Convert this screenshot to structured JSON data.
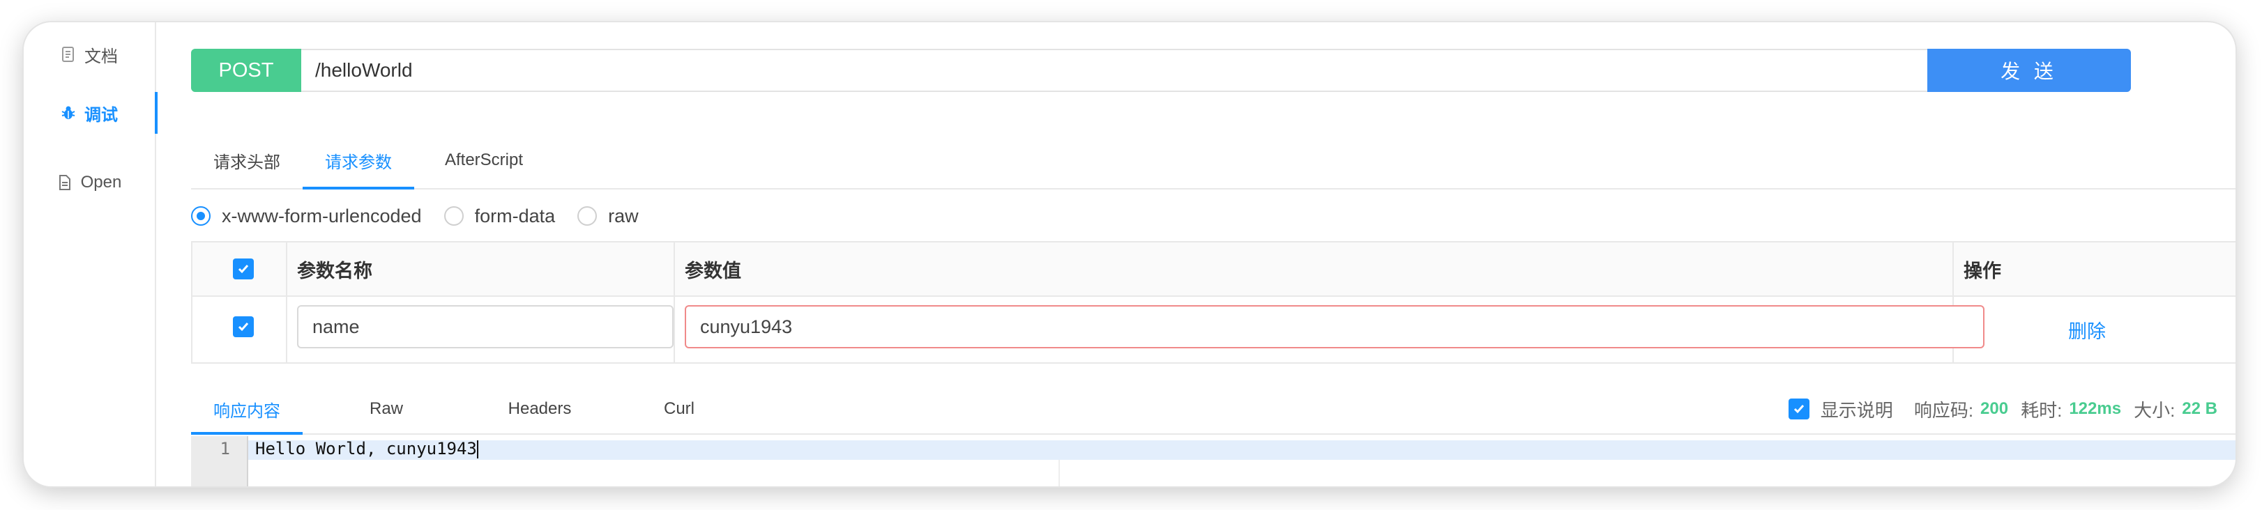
{
  "sidebar": {
    "items": [
      {
        "label": "文档",
        "icon": "document-icon"
      },
      {
        "label": "调试",
        "icon": "bug-icon"
      },
      {
        "label": "Open",
        "icon": "file-icon"
      }
    ]
  },
  "request": {
    "method": "POST",
    "url": "/helloWorld",
    "send_label": "发 送"
  },
  "tabs": [
    {
      "label": "请求头部"
    },
    {
      "label": "请求参数"
    },
    {
      "label": "AfterScript"
    }
  ],
  "body_type": {
    "options": [
      "x-www-form-urlencoded",
      "form-data",
      "raw"
    ],
    "selected": "x-www-form-urlencoded"
  },
  "params_table": {
    "headers": [
      "参数名称",
      "参数值",
      "操作"
    ],
    "rows": [
      {
        "name": "name",
        "value": "cunyu1943",
        "action": "删除"
      }
    ]
  },
  "response": {
    "tabs": [
      "响应内容",
      "Raw",
      "Headers",
      "Curl"
    ],
    "show_desc_label": "显示说明",
    "status_label": "响应码:",
    "status_value": "200",
    "time_label": "耗时:",
    "time_value": "122ms",
    "size_label": "大小:",
    "size_value": "22 B",
    "lines": [
      {
        "num": "1",
        "text": "Hello World, cunyu1943"
      }
    ]
  },
  "colors": {
    "accent": "#1890ff",
    "post": "#49cc90",
    "send": "#3d8ff5",
    "error_border": "#f08a8a"
  }
}
